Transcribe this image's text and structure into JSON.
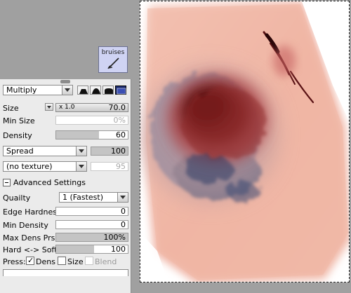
{
  "brush_tile": {
    "label": "bruises",
    "icon": "brush-tool-icon"
  },
  "blend": {
    "value": "Multiply",
    "shapes": [
      "hard-edge-icon",
      "medium-edge-icon",
      "soft-edge-icon",
      "square-edge-icon"
    ],
    "selected_shape": 3
  },
  "size": {
    "label": "Size",
    "multiplier": "x 1.0",
    "value": "70.0"
  },
  "min_size": {
    "label": "Min Size",
    "value": "0%"
  },
  "density": {
    "label": "Density",
    "value": "60",
    "fill_pct": 60
  },
  "texture_mode": {
    "value": "Spread",
    "amount": "100"
  },
  "texture": {
    "value": "(no texture)",
    "amount": "95"
  },
  "advanced": {
    "label": "Advanced Settings"
  },
  "quality": {
    "label": "Quailty",
    "value": "1 (Fastest)"
  },
  "edge_hardness": {
    "label": "Edge Hardness",
    "value": "0"
  },
  "min_density": {
    "label": "Min Density",
    "value": "0"
  },
  "max_dens_prs": {
    "label": "Max Dens Prs.",
    "value": "100%",
    "fill_pct": 100
  },
  "hard_soft": {
    "label": "Hard <-> Soft",
    "value": "100",
    "fill_pct": 53
  },
  "press": {
    "label": "Press:",
    "dens": {
      "label": "Dens",
      "checked": true
    },
    "size": {
      "label": "Size",
      "checked": false
    },
    "blend": {
      "label": "Blend",
      "checked": false
    }
  }
}
